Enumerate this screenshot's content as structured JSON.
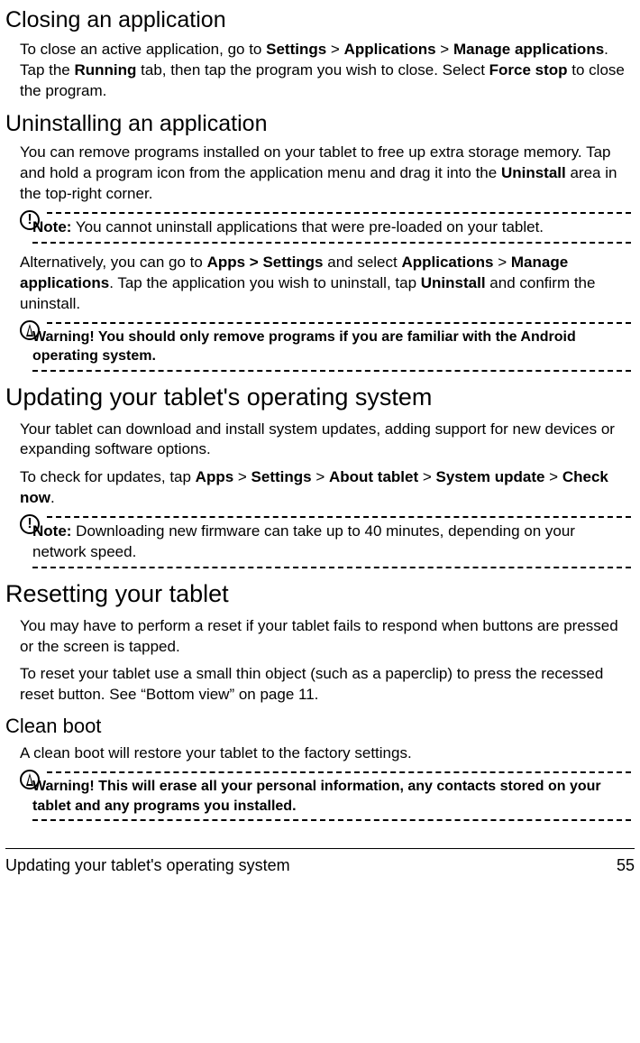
{
  "sections": {
    "closing": {
      "title": "Closing an application",
      "body_html": "To close an active application, go to <strong>Settings</strong> > <strong>Applications</strong> > <strong>Manage applications</strong>. Tap the <strong>Running</strong> tab, then tap the program you wish to close. Select <strong>Force stop</strong> to close the program."
    },
    "uninstall": {
      "title": "Uninstalling an application",
      "body1_html": "You can remove programs installed on your tablet to free up extra storage memory. Tap and hold a program icon from the application menu and drag it into the <strong>Uninstall</strong> area in the top-right corner.",
      "note1_html": "<strong>Note:</strong> You cannot uninstall applications that were pre-loaded on your tablet.",
      "body2_html": "Alternatively, you can go to <strong>Apps > Settings</strong> and select <strong>Applications</strong> > <strong>Manage applications</strong>. Tap the application you wish to uninstall, tap <strong>Uninstall</strong> and confirm the uninstall.",
      "warning_html": "Warning! You should only remove programs if you are familiar with the Android operating system."
    },
    "updating": {
      "title": "Updating your tablet's operating system",
      "body1": "Your tablet can download and install system updates, adding support for new devices or expanding software options.",
      "body2_html": "To check for updates, tap <strong>Apps</strong> > <strong>Settings</strong> > <strong>About tablet</strong> > <strong>System update</strong> > <strong>Check now</strong>.",
      "note_html": "<strong>Note:</strong> Downloading new firmware can take up to 40 minutes, depending on your network speed."
    },
    "resetting": {
      "title": "Resetting your tablet",
      "body1": "You may have to perform a reset if your tablet fails to respond when buttons are pressed or the screen is tapped.",
      "body2": "To reset your tablet use a small thin object (such as a paperclip) to press the recessed reset button. See “Bottom view” on page 11."
    },
    "cleanboot": {
      "title": "Clean boot",
      "body": "A clean boot will restore your tablet to the factory settings.",
      "warning_html": "Warning! This will erase all your personal information, any contacts stored on your tablet and any programs you installed."
    }
  },
  "footer": {
    "left": "Updating your tablet's operating system",
    "right": "55"
  }
}
